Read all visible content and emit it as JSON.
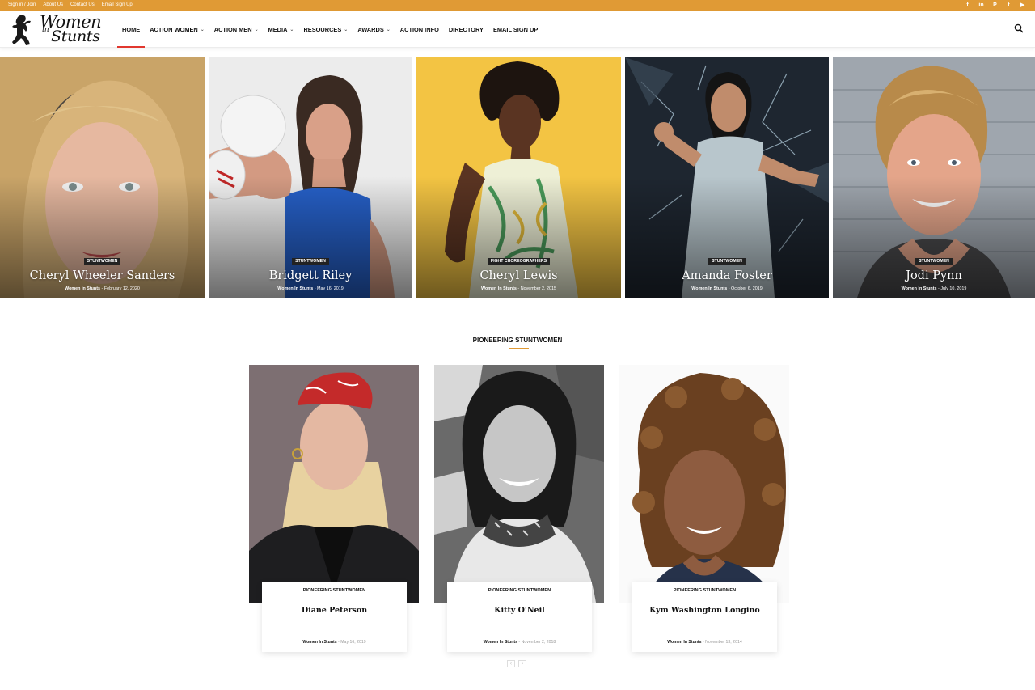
{
  "topbar": {
    "links": [
      "Sign in / Join",
      "About Us",
      "Contact Us",
      "Email Sign Up"
    ],
    "social": [
      {
        "name": "facebook-icon",
        "glyph": "f"
      },
      {
        "name": "linkedin-icon",
        "glyph": "in"
      },
      {
        "name": "pinterest-icon",
        "glyph": "P"
      },
      {
        "name": "twitter-icon",
        "glyph": "t"
      },
      {
        "name": "youtube-icon",
        "glyph": "▶"
      }
    ],
    "color": "#e09a35"
  },
  "logo": {
    "line1": "Women",
    "line2": "in",
    "line3": "Stunts"
  },
  "nav": [
    {
      "label": "HOME",
      "dropdown": false,
      "active": true
    },
    {
      "label": "ACTION WOMEN",
      "dropdown": true
    },
    {
      "label": "ACTION MEN",
      "dropdown": true
    },
    {
      "label": "MEDIA",
      "dropdown": true
    },
    {
      "label": "RESOURCES",
      "dropdown": true
    },
    {
      "label": "AWARDS",
      "dropdown": true
    },
    {
      "label": "ACTION INFO",
      "dropdown": false
    },
    {
      "label": "DIRECTORY",
      "dropdown": false
    },
    {
      "label": "EMAIL SIGN UP",
      "dropdown": false
    }
  ],
  "hero": [
    {
      "category": "STUNTWOMEN",
      "name": "Cheryl Wheeler Sanders",
      "author": "Women In Stunts",
      "date": "February 12, 2020"
    },
    {
      "category": "STUNTWOMEN",
      "name": "Bridgett Riley",
      "author": "Women In Stunts",
      "date": "May 16, 2019"
    },
    {
      "category": "FIGHT CHOREOGRAPHERS",
      "name": "Cheryl Lewis",
      "author": "Women In Stunts",
      "date": "November 2, 2015"
    },
    {
      "category": "STUNTWOMEN",
      "name": "Amanda Foster",
      "author": "Women In Stunts",
      "date": "October 6, 2019"
    },
    {
      "category": "STUNTWOMEN",
      "name": "Jodi Pynn",
      "author": "Women In Stunts",
      "date": "July 10, 2019"
    }
  ],
  "section": {
    "title": "PIONEERING STUNTWOMEN",
    "cards": [
      {
        "category": "PIONEERING STUNTWOMEN",
        "name": "Diane Peterson",
        "author": "Women In Stunts",
        "date": "May 16, 2019"
      },
      {
        "category": "PIONEERING STUNTWOMEN",
        "name": "Kitty O'Neil",
        "author": "Women In Stunts",
        "date": "November 2, 2018"
      },
      {
        "category": "PIONEERING STUNTWOMEN",
        "name": "Kym Washington Longino",
        "author": "Women In Stunts",
        "date": "November 13, 2014"
      }
    ],
    "pager": {
      "prev": "‹",
      "next": "›"
    }
  }
}
